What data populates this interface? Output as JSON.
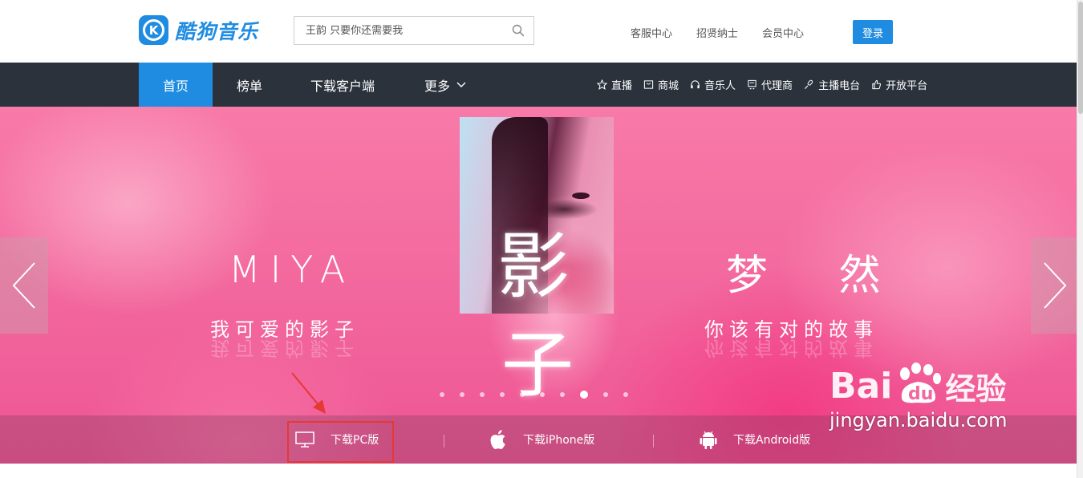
{
  "app": {
    "logo_text": "酷狗音乐",
    "logo_letter": "K",
    "logo_icon": "kugou-logo-icon"
  },
  "search": {
    "placeholder": "王韵 只要你还需要我",
    "icon": "search-icon"
  },
  "top_links": [
    "客服中心",
    "招贤纳士",
    "会员中心"
  ],
  "login_label": "登录",
  "nav": {
    "items": [
      {
        "label": "首页",
        "active": true
      },
      {
        "label": "榜单",
        "active": false
      },
      {
        "label": "下载客户端",
        "active": false
      },
      {
        "label": "更多",
        "active": false
      }
    ],
    "more_icon": "chevron-down-icon",
    "right_links": [
      {
        "label": "直播",
        "icon": "star-icon"
      },
      {
        "label": "商城",
        "icon": "mall-icon"
      },
      {
        "label": "音乐人",
        "icon": "headphones-icon"
      },
      {
        "label": "代理商",
        "icon": "agent-icon"
      },
      {
        "label": "主播电台",
        "icon": "mic-icon"
      },
      {
        "label": "开放平台",
        "icon": "thumbs-up-icon"
      }
    ]
  },
  "banner": {
    "left_title": "MIYA",
    "left_subtitle": "我可爱的影子",
    "center_char_1": "影",
    "center_char_2": "子",
    "right_title": "梦 然",
    "right_subtitle": "你该有对的故事",
    "slide_count": 10,
    "active_slide": 8,
    "prev_icon": "chevron-left-icon",
    "next_icon": "chevron-right-icon"
  },
  "downloads": [
    {
      "label": "下载PC版",
      "icon": "monitor-icon"
    },
    {
      "label": "下载iPhone版",
      "icon": "apple-icon"
    },
    {
      "label": "下载Android版",
      "icon": "android-icon"
    }
  ],
  "watermark": {
    "brand_1": "Bai",
    "brand_2": "du",
    "brand_3": "经验",
    "url": "jingyan.baidu.com"
  },
  "colors": {
    "brand_blue": "#1f8ce2",
    "nav_dark": "#2b323c",
    "highlight_red": "#e53935"
  }
}
